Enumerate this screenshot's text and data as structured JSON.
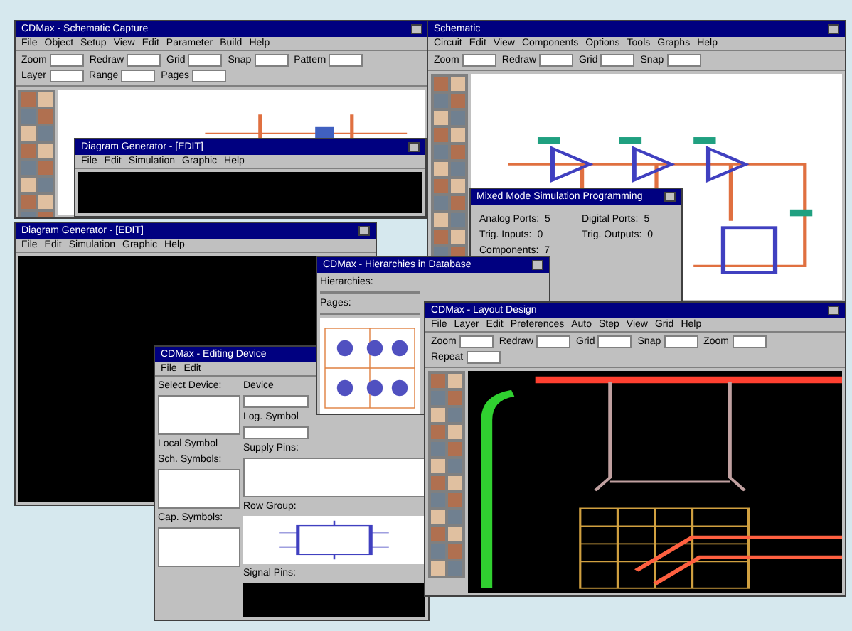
{
  "windows": [
    {
      "kind": "schematic",
      "title": "CDMax - Schematic Capture",
      "menus": [
        "File",
        "Object",
        "Setup",
        "View",
        "Edit",
        "Parameter",
        "Build",
        "Help"
      ],
      "toolbar": [
        "Zoom",
        "Redraw",
        "Grid",
        "Snap",
        "Pattern",
        "Layer",
        "Range",
        "Pages"
      ]
    },
    {
      "kind": "circuit",
      "title": "Schematic",
      "menus": [
        "Circuit",
        "Edit",
        "View",
        "Components",
        "Options",
        "Tools",
        "Graphs",
        "Help"
      ],
      "toolbar": [
        "Zoom",
        "Redraw",
        "Grid",
        "Snap"
      ]
    },
    {
      "kind": "terminal",
      "title": "Diagram Generator - [EDIT]",
      "menus": [
        "File",
        "Edit",
        "Simulation",
        "Graphic",
        "Help"
      ]
    },
    {
      "kind": "terminal",
      "title": "Diagram Generator - [EDIT]",
      "menus": [
        "File",
        "Edit",
        "Simulation",
        "Graphic",
        "Help"
      ]
    },
    {
      "kind": "dialog",
      "title": "Mixed Mode Simulation Programming",
      "fields": [
        {
          "label": "Analog Ports:",
          "value": "5"
        },
        {
          "label": "Digital Ports:",
          "value": "5"
        },
        {
          "label": "Trig. Inputs:",
          "value": "0"
        },
        {
          "label": "Trig. Outputs:",
          "value": "0"
        },
        {
          "label": "Components:",
          "value": "7"
        }
      ]
    },
    {
      "kind": "device",
      "title": "CDMax - Editing Device",
      "menus": [
        "File",
        "Edit"
      ],
      "left": [
        {
          "kind": "label",
          "text": "Select Device:"
        },
        {
          "kind": "list"
        },
        {
          "kind": "label",
          "text": "Local Symbol"
        },
        {
          "kind": "label",
          "text": "Sch. Symbols:"
        },
        {
          "kind": "list"
        },
        {
          "kind": "label",
          "text": "Cap. Symbols:"
        },
        {
          "kind": "list"
        }
      ],
      "right": [
        {
          "kind": "label",
          "text": "Device"
        },
        {
          "kind": "field"
        },
        {
          "kind": "label",
          "text": "Log. Symbol"
        },
        {
          "kind": "field"
        },
        {
          "kind": "label",
          "text": "Supply Pins:"
        },
        {
          "kind": "list"
        },
        {
          "kind": "label",
          "text": "Row Group:"
        },
        {
          "kind": "symbol"
        },
        {
          "kind": "label",
          "text": "Signal Pins:"
        },
        {
          "kind": "screen"
        }
      ]
    },
    {
      "kind": "hierarchy",
      "title": "CDMax - Hierarchies in Database",
      "fields": [
        {
          "label": "Hierarchies:"
        },
        {
          "label": "Pages:"
        }
      ]
    },
    {
      "kind": "layout",
      "title": "CDMax - Layout Design",
      "menus": [
        "File",
        "Layer",
        "Edit",
        "Preferences",
        "Auto",
        "Step",
        "View",
        "Grid",
        "Help"
      ],
      "toolbar": [
        "Zoom",
        "Redraw",
        "Grid",
        "Snap",
        "Zoom",
        "Repeat"
      ]
    }
  ]
}
